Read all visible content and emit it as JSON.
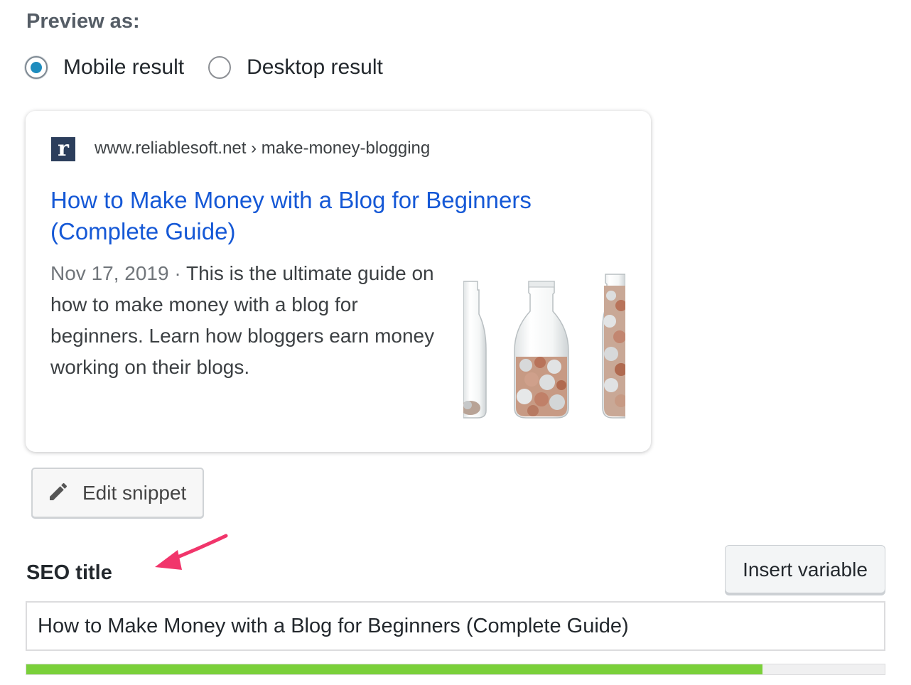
{
  "preview": {
    "heading": "Preview as:",
    "options": [
      {
        "label": "Mobile result",
        "checked": true
      },
      {
        "label": "Desktop result",
        "checked": false
      }
    ]
  },
  "snippet": {
    "favicon_letter": "r",
    "breadcrumb": "www.reliablesoft.net › make-money-blogging",
    "title": "How to Make Money with a Blog for Beginners (Complete Guide)",
    "date": "Nov 17, 2019",
    "separator": " · ",
    "description": "This is the ultimate guide on how to make money with a blog for beginners. Learn how bloggers earn money working on their blogs.",
    "thumbnail_icon": "coin-jars-image"
  },
  "edit_snippet": {
    "label": "Edit snippet",
    "icon": "pencil-icon"
  },
  "seo_title": {
    "label": "SEO title",
    "insert_variable_label": "Insert variable",
    "value": "How to Make Money with a Blog for Beginners (Complete Guide)",
    "progress": 0.858,
    "progress_color": "#7ad03a"
  },
  "colors": {
    "link": "#1558d6",
    "radio_accent": "#1e8cbe",
    "annotation_arrow": "#f1356b",
    "favicon_bg": "#2c3e5c"
  }
}
